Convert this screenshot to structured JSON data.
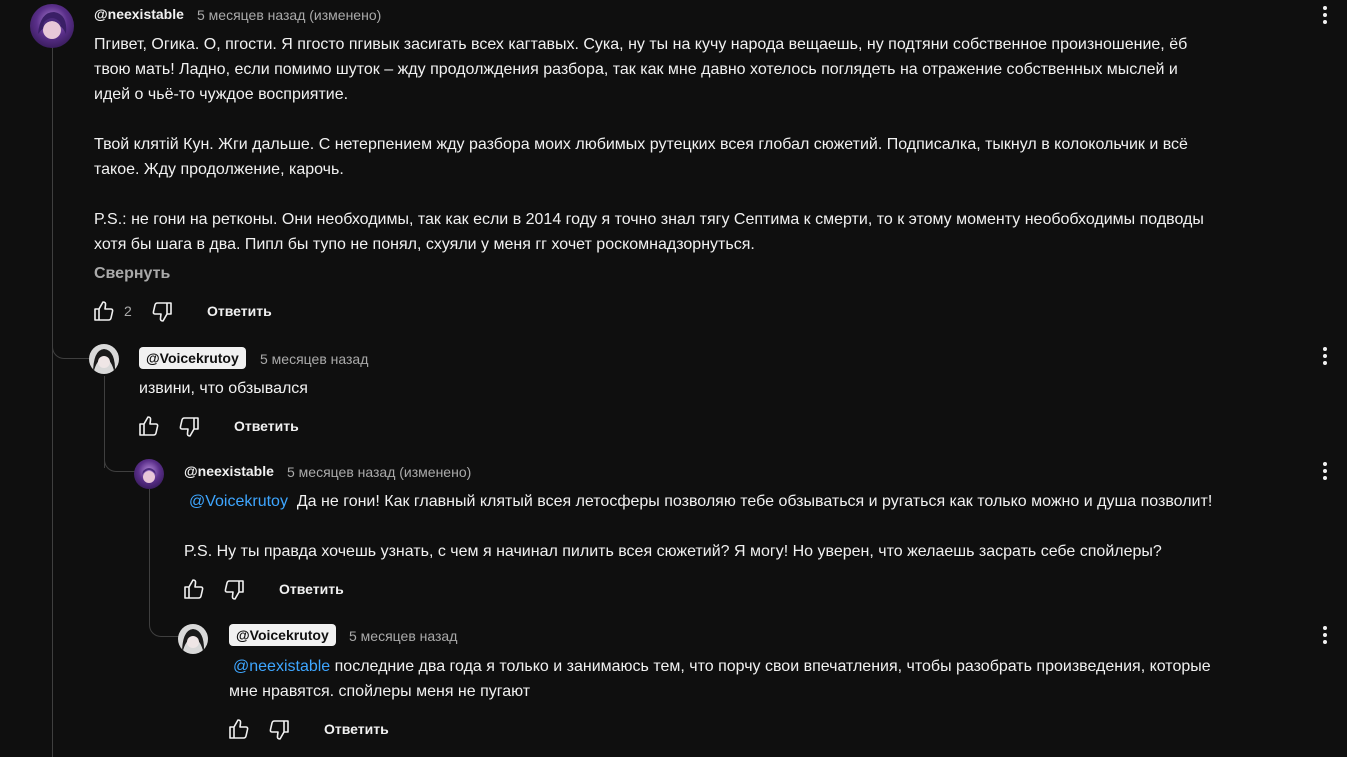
{
  "comments": [
    {
      "author": "@neexistable",
      "time": "5 месяцев назад (изменено)",
      "paragraphs": [
        [
          "Пгивет, Огика. О, пгости. Я пгосто пгивык засигать всех кагтавых. Сука, ну ты на кучу народа вещаешь, ну подтяни собственное произношение, ёб",
          "твою мать!  Ладно, если помимо шуток – жду продолждения разбора, так как мне давно хотелось поглядеть на отражение собственных мыслей и",
          "идей о чьё-то чуждое восприятие."
        ],
        [
          "Твой клятій Кун. Жги дальше. С нетерпением жду разбора моих любимых рутецких всея глобал сюжетий. Подписалка, тыкнул в колокольчик и всё",
          "такое. Жду продолжение, карочь."
        ],
        [
          "P.S.: не гони на ретконы. Они необходимы, так как если в 2014 году я точно знал тягу Септима к смерти, то к этому моменту необобходимы подводы",
          "хотя бы шага в два. Пипл бы тупо не понял, схуяли у меня гг хочет роскомнадзорнуться."
        ]
      ],
      "collapse": "Свернуть",
      "likes": "2",
      "reply": "Ответить"
    },
    {
      "author": "@Voicekrutoy",
      "time": "5 месяцев назад",
      "text": "извини, что обзывался",
      "reply": "Ответить"
    },
    {
      "author": "@neexistable",
      "time": "5 месяцев назад (изменено)",
      "mention": "@Voicekrutoy",
      "text1": "Да не гони! Как главный клятый всея летосферы позволяю тебе обзываться и ругаться как только можно и душа позволит!",
      "text2": "P.S. Ну ты правда хочешь узнать, с чем я начинал пилить всея сюжетий? Я могу! Но уверен, что желаешь засрать себе спойлеры?",
      "reply": "Ответить"
    },
    {
      "author": "@Voicekrutoy",
      "time": "5 месяцев назад",
      "mention": "@neexistable",
      "line1": "последние два года я только и занимаюсь тем, что порчу свои впечатления, чтобы разобрать произведения, которые",
      "line2": "мне нравятся. спойлеры меня не пугают",
      "reply": "Ответить"
    }
  ],
  "icons": {
    "like": "thumb-up-icon",
    "dislike": "thumb-down-icon",
    "more": "more-vertical-icon"
  },
  "colors": {
    "background": "#0f0f0f",
    "mention": "#3ea6ff",
    "secondary_text": "#aaaaaa",
    "chip_bg": "#f1f1f1"
  }
}
